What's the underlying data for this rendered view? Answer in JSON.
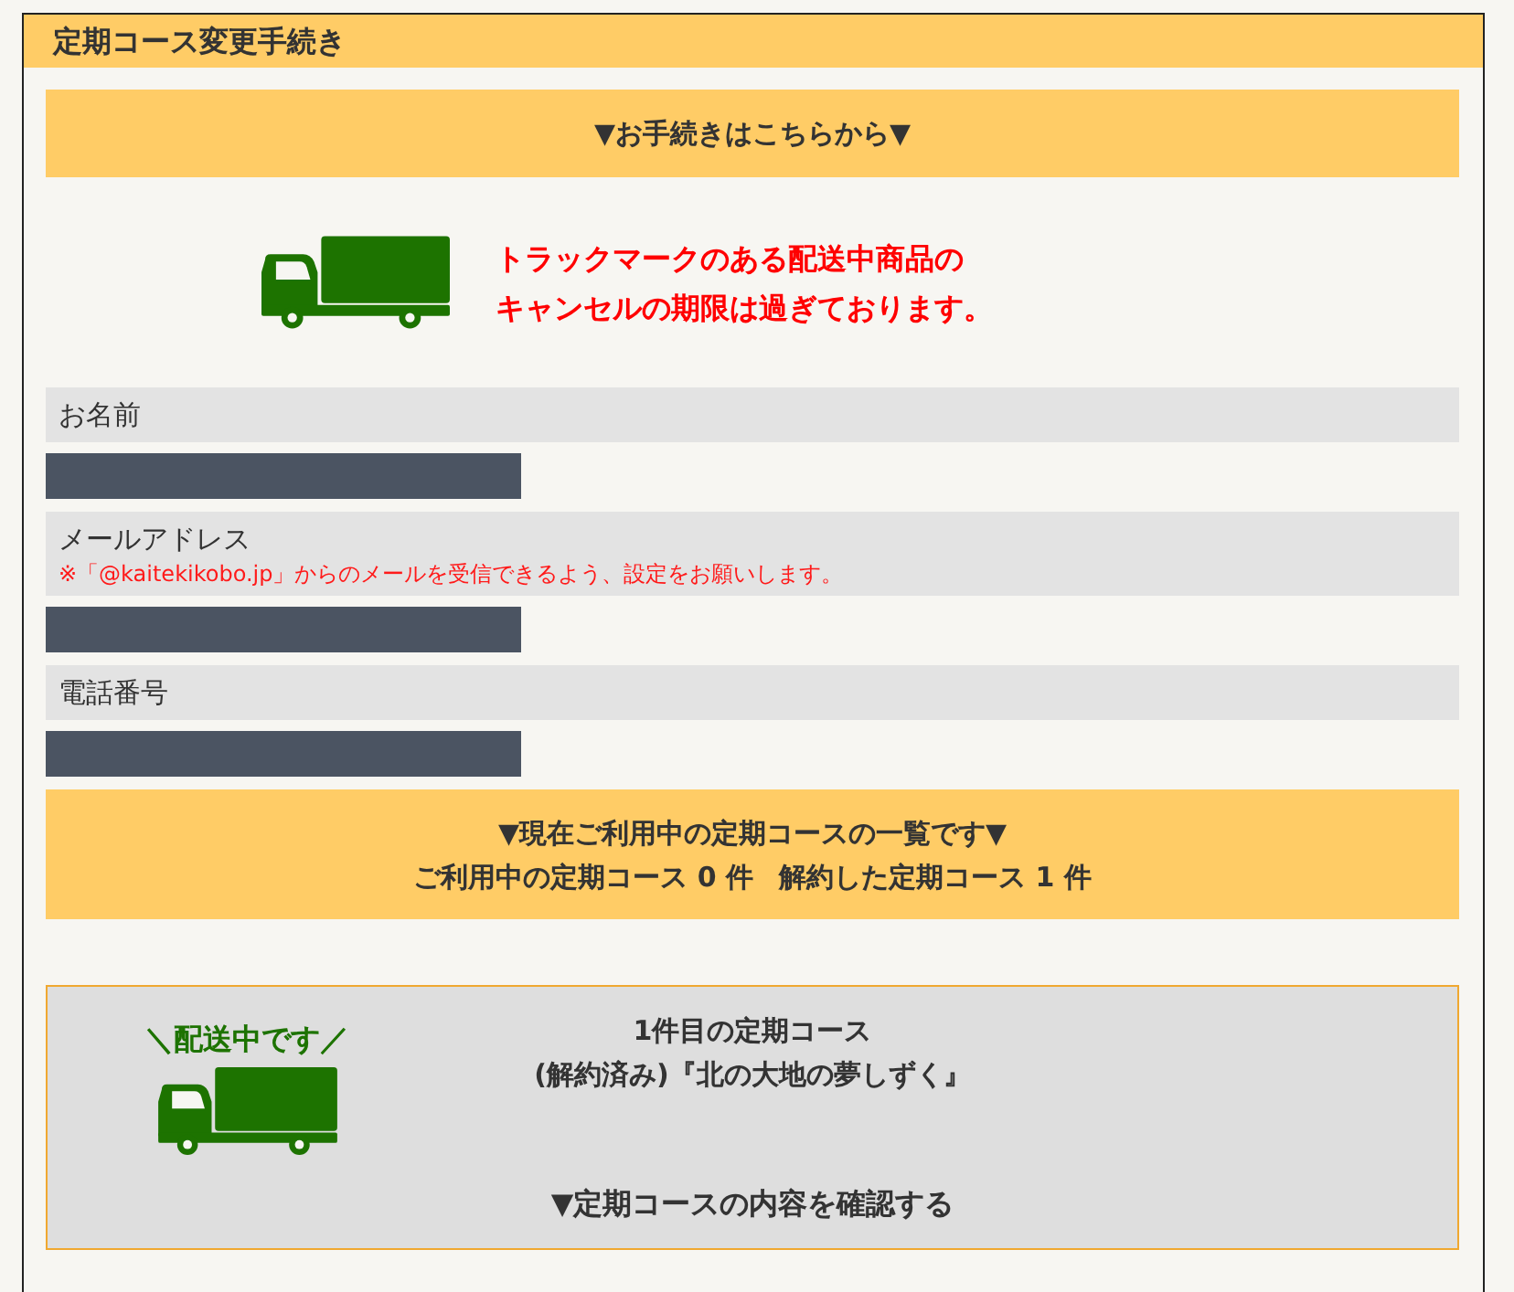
{
  "page_title": "定期コース変更手続き",
  "procedure_banner": "▼お手続きはこちらから▼",
  "notice": {
    "lines": [
      "トラックマークのある配送中商品の",
      "キャンセルの期限は過ぎております。"
    ]
  },
  "form": {
    "fields": [
      {
        "label": "お名前"
      },
      {
        "label": "メールアドレス",
        "note": "※「@kaitekikobo.jp」からのメールを受信できるよう、設定をお願いします。"
      },
      {
        "label": "電話番号"
      }
    ]
  },
  "course_summary": {
    "heading": "▼現在ご利用中の定期コースの一覧です▼",
    "active_count": "ご利用中の定期コース 0 件",
    "cancelled_count": "解約した定期コース 1 件"
  },
  "courses": [
    {
      "in_transit": true,
      "badge": "＼配送中です／",
      "title": "1件目の定期コース",
      "name": "(解約済み)『北の大地の夢しずく』",
      "details_link": "▼定期コースの内容を確認する"
    }
  ]
}
